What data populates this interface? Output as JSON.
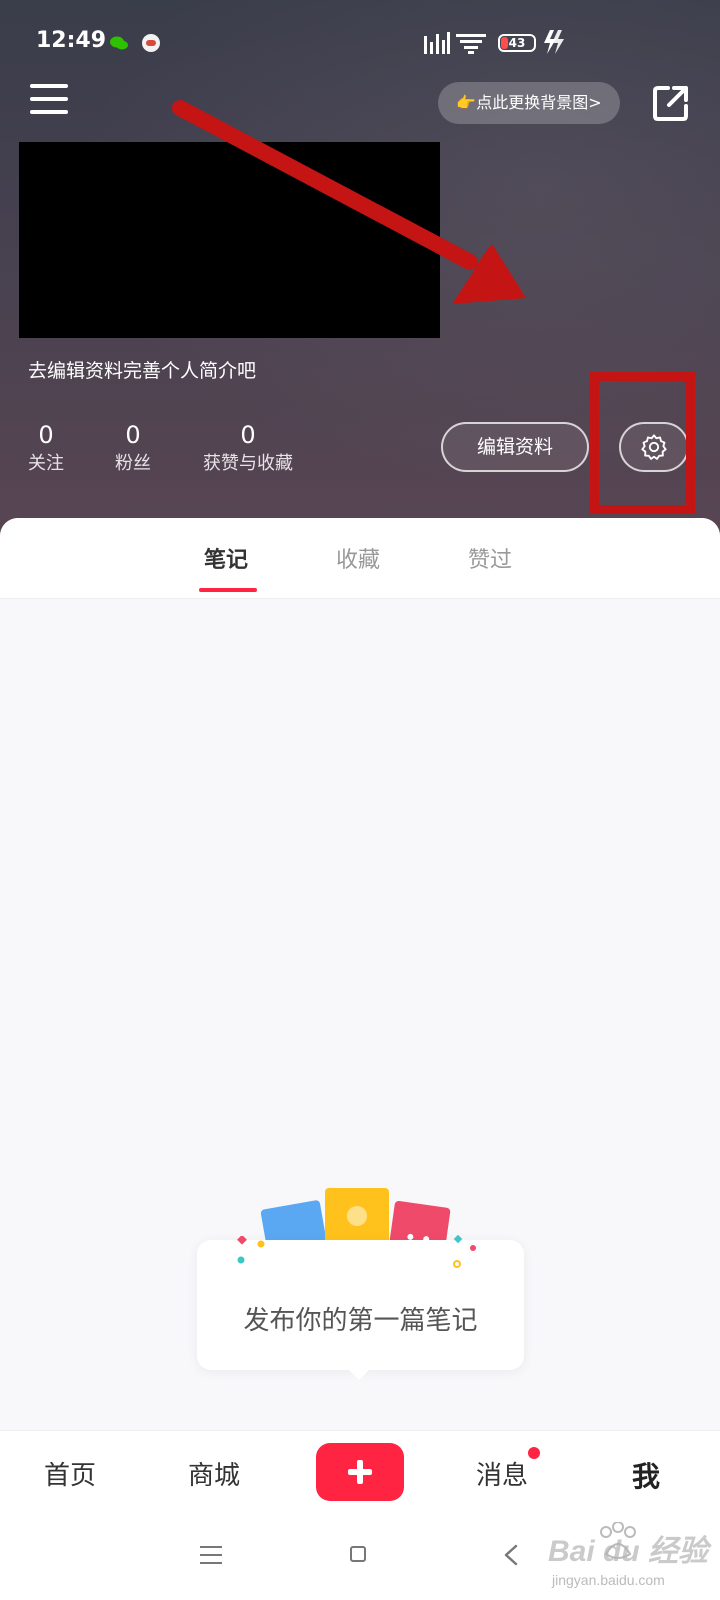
{
  "status_bar": {
    "time": "12:49",
    "battery": "43"
  },
  "header": {
    "background_change_label": "👉点此更换背景图>"
  },
  "profile": {
    "bio_prompt": "去编辑资料完善个人简介吧",
    "stats": [
      {
        "value": "0",
        "label": "关注"
      },
      {
        "value": "0",
        "label": "粉丝"
      },
      {
        "value": "0",
        "label": "获赞与收藏"
      }
    ],
    "edit_button": "编辑资料"
  },
  "tabs": [
    {
      "label": "笔记",
      "active": true
    },
    {
      "label": "收藏",
      "active": false
    },
    {
      "label": "赞过",
      "active": false
    }
  ],
  "empty_state": {
    "text": "发布你的第一篇笔记"
  },
  "bottom_nav": [
    {
      "label": "首页"
    },
    {
      "label": "商城"
    },
    {
      "label": "消息"
    },
    {
      "label": "我"
    }
  ],
  "watermark": {
    "brand": "Bai du 经验",
    "domain": "jingyan.baidu.com"
  },
  "colors": {
    "accent": "#ff2442",
    "annotation": "#c41414"
  }
}
